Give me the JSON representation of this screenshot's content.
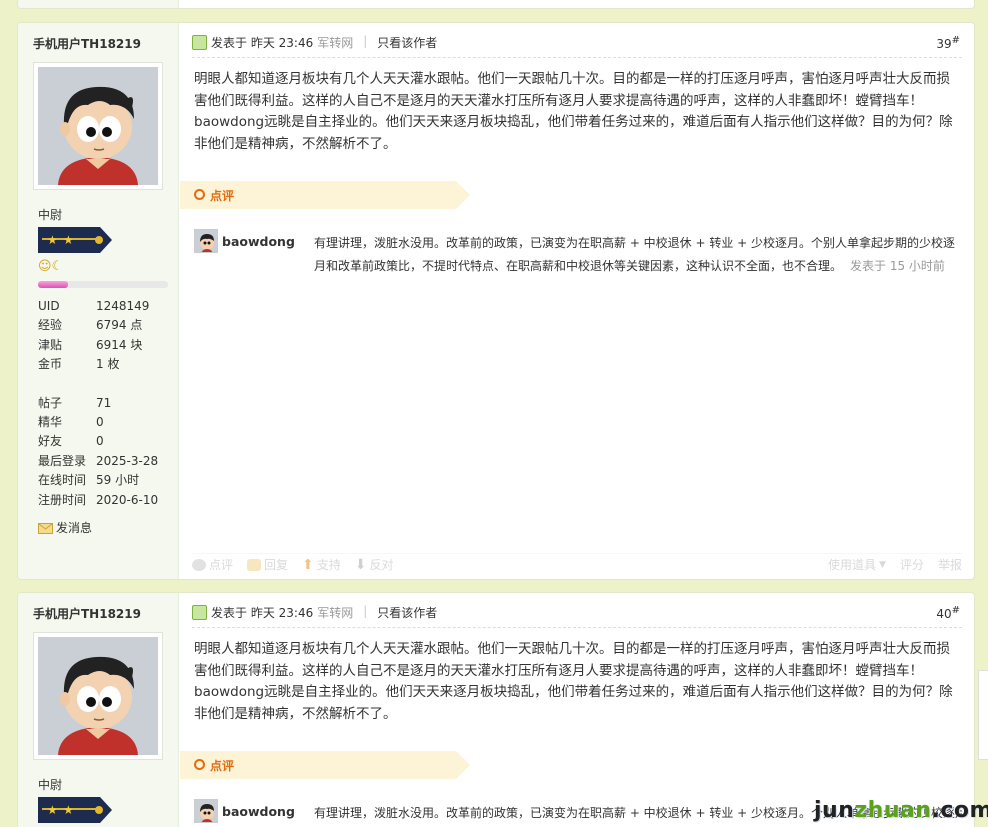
{
  "posts": [
    {
      "username": "手机用户TH18219",
      "rank": "中尉",
      "progress": 0.23,
      "stats": [
        {
          "k": "UID",
          "v": "1248149"
        },
        {
          "k": "经验",
          "v": "6794 点"
        },
        {
          "k": "津贴",
          "v": "6914 块"
        },
        {
          "k": "金币",
          "v": "1 枚"
        }
      ],
      "stats2": [
        {
          "k": "帖子",
          "v": "71"
        },
        {
          "k": "精华",
          "v": "0"
        },
        {
          "k": "好友",
          "v": "0"
        },
        {
          "k": "最后登录",
          "v": "2025-3-28"
        },
        {
          "k": "在线时间",
          "v": "59 小时"
        },
        {
          "k": "注册时间",
          "v": "2020-6-10"
        }
      ],
      "send_message": "发消息",
      "posted_label": "发表于 昨天 23:46",
      "source": "军转网",
      "only_author": "只看该作者",
      "floor": "39",
      "content": "明眼人都知道逐月板块有几个人天天灌水跟帖。他们一天跟帖几十次。目的都是一样的打压逐月呼声，害怕逐月呼声壮大反而损害他们既得利益。这样的人自己不是逐月的天天灌水打压所有逐月人要求提高待遇的呼声，这样的人非蠢即坏！螳臂挡车！baowdong远眺是自主择业的。他们天天来逐月板块捣乱，他们带着任务过来的，难道后面有人指示他们这样做？目的为何？除非他们是精神病，不然解析不了。",
      "review_label": "点评",
      "comment": {
        "name": "baowdong",
        "text": "有理讲理，泼脏水没用。改革前的政策，已演变为在职高薪 + 中校退休 + 转业 + 少校逐月。个别人单拿起步期的少校逐月和改革前政策比，不提时代特点、在职高薪和中校退休等关键因素，这种认识不全面，也不合理。",
        "time": "发表于 15 小时前"
      },
      "actions": {
        "review": "点评",
        "reply": "回复",
        "support": "支持",
        "oppose": "反对",
        "tools": "使用道具",
        "rate": "评分",
        "report": "举报"
      }
    },
    {
      "username": "手机用户TH18219",
      "rank": "中尉",
      "posted_label": "发表于 昨天 23:46",
      "source": "军转网",
      "only_author": "只看该作者",
      "floor": "40",
      "content": "明眼人都知道逐月板块有几个人天天灌水跟帖。他们一天跟帖几十次。目的都是一样的打压逐月呼声，害怕逐月呼声壮大反而损害他们既得利益。这样的人自己不是逐月的天天灌水打压所有逐月人要求提高待遇的呼声，这样的人非蠢即坏！螳臂挡车！baowdong远眺是自主择业的。他们天天来逐月板块捣乱，他们带着任务过来的，难道后面有人指示他们这样做？目的为何？除非他们是精神病，不然解析不了。",
      "review_label": "点评",
      "comment": {
        "name": "baowdong",
        "text": "有理讲理，泼脏水没用。改革前的政策，已演变为在职高薪 + 中校退休 + 转业 + 少校逐月。个别人单拿起步期的少校逐月和"
      }
    }
  ],
  "watermark": {
    "prefix": "jun",
    "mid": "zhuan",
    "suffix": ".com"
  },
  "colors": {
    "accent_orange": "#e06d12",
    "sidebar_bg": "#f4f8ee",
    "page_bg": "#eef2c9"
  }
}
